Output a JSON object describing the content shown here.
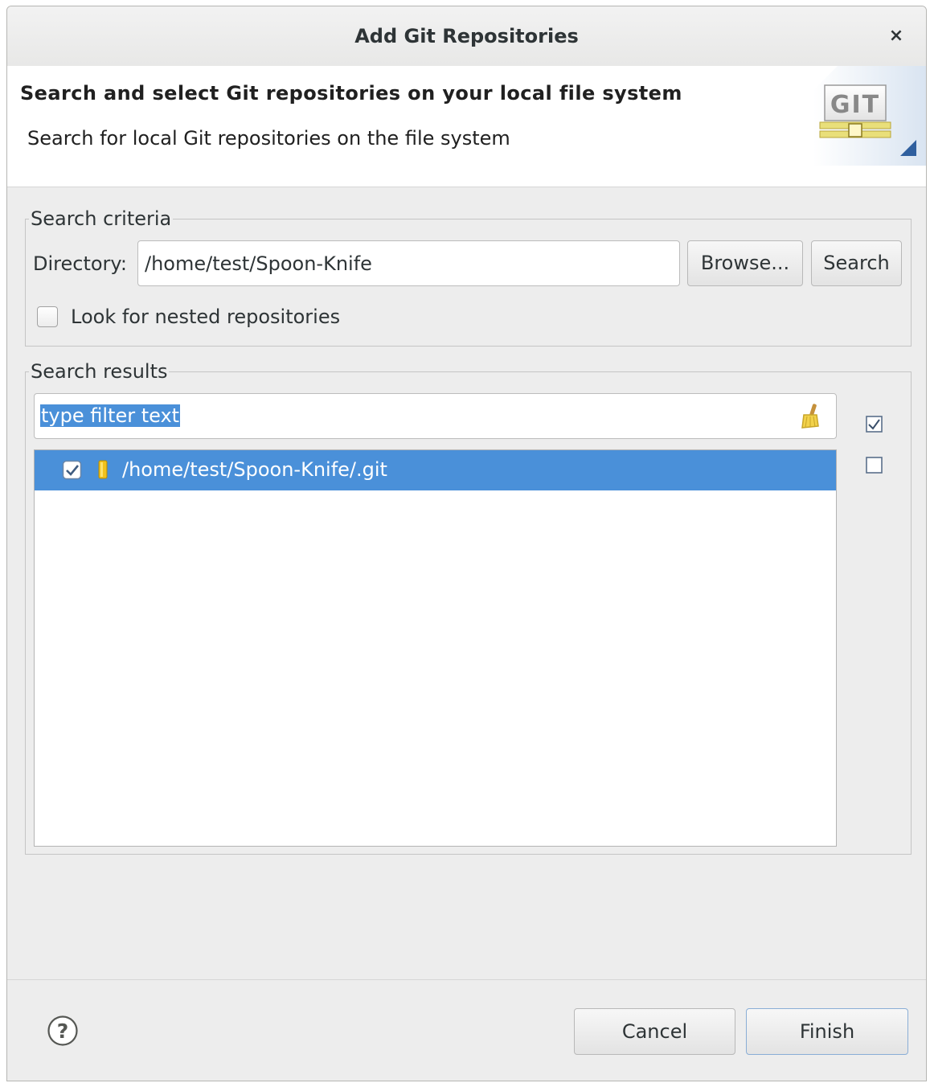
{
  "window": {
    "title": "Add Git Repositories",
    "close_icon": "×"
  },
  "header": {
    "title": "Search and select Git repositories on your local file system",
    "description": "Search for local Git repositories on the file system",
    "banner_icon": "git-banner-icon",
    "banner_text": "GIT"
  },
  "search_criteria": {
    "legend": "Search criteria",
    "directory_label": "Directory:",
    "directory_value": "/home/test/Spoon-Knife",
    "browse_label": "Browse...",
    "search_label": "Search",
    "nested_label": "Look for nested repositories",
    "nested_checked": false
  },
  "search_results": {
    "legend": "Search results",
    "filter_text": "type filter text",
    "clear_icon": "broom-icon",
    "select_all_icon": "checkbox-checked-icon",
    "deselect_all_icon": "checkbox-empty-icon",
    "items": [
      {
        "path": "/home/test/Spoon-Knife/.git",
        "checked": true,
        "icon": "repository-icon"
      }
    ]
  },
  "footer": {
    "help_icon": "?",
    "cancel_label": "Cancel",
    "finish_label": "Finish"
  },
  "colors": {
    "selection": "#4a90d9",
    "dialog_bg": "#ededed"
  }
}
